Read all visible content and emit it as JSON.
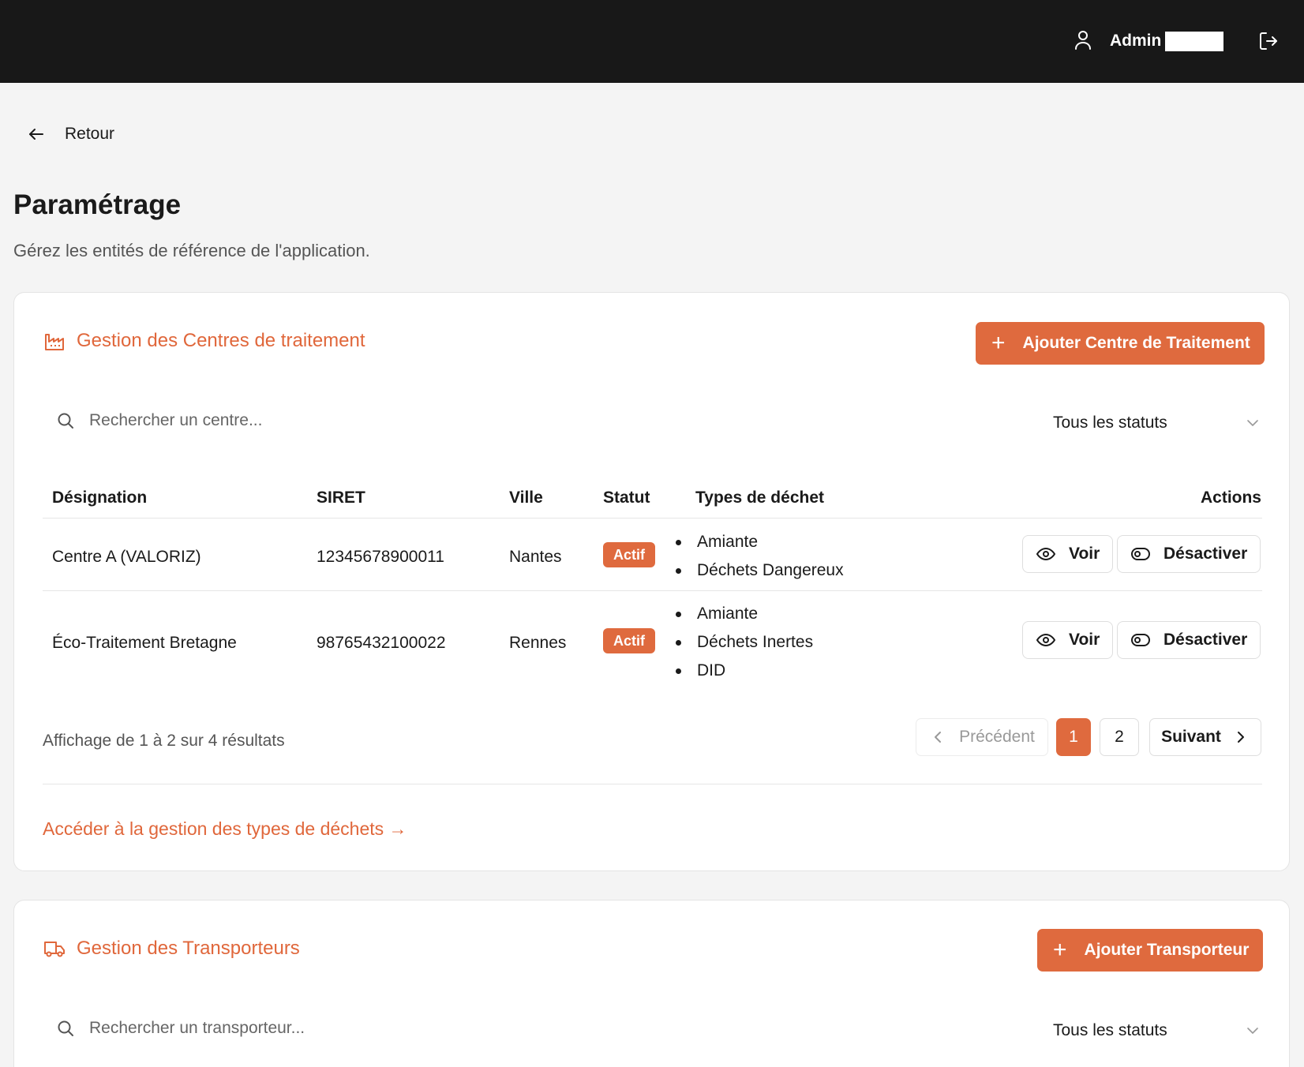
{
  "header": {
    "user_icon": "user-icon",
    "user_name": "Admin",
    "logout_icon": "logout-icon"
  },
  "nav": {
    "back_icon": "arrow-left-icon",
    "back_label": "Retour"
  },
  "page": {
    "title": "Paramétrage",
    "subtitle": "Gérez les entités de référence de l'application."
  },
  "centres": {
    "icon": "factory-icon",
    "title": "Gestion des Centres de traitement",
    "add_label": "Ajouter Centre de Traitement",
    "add_icon": "plus-icon",
    "search_placeholder": "Rechercher un centre...",
    "status_filter": "Tous les statuts",
    "columns": {
      "designation": "Désignation",
      "siret": "SIRET",
      "ville": "Ville",
      "statut": "Statut",
      "types": "Types de déchet",
      "actions": "Actions"
    },
    "rows": [
      {
        "designation": "Centre A (VALORIZ)",
        "siret": "12345678900011",
        "ville": "Nantes",
        "statut": "Actif",
        "types": [
          "Amiante",
          "Déchets Dangereux"
        ],
        "view_label": "Voir",
        "deactivate_label": "Désactiver"
      },
      {
        "designation": "Éco-Traitement Bretagne",
        "siret": "98765432100022",
        "ville": "Rennes",
        "statut": "Actif",
        "types": [
          "Amiante",
          "Déchets Inertes",
          "DID"
        ],
        "view_label": "Voir",
        "deactivate_label": "Désactiver"
      }
    ],
    "results_text": "Affichage de 1 à 2 sur 4 résultats",
    "pagination": {
      "previous": "Précédent",
      "pages": [
        "1",
        "2"
      ],
      "current_page": "1",
      "next": "Suivant"
    },
    "waste_types_link": "Accéder à la gestion des types de déchets →"
  },
  "transporteurs": {
    "icon": "truck-icon",
    "title": "Gestion des Transporteurs",
    "add_label": "Ajouter Transporteur",
    "add_icon": "plus-icon",
    "search_placeholder": "Rechercher un transporteur...",
    "status_filter": "Tous les statuts"
  },
  "colors": {
    "accent": "#df6a3e",
    "topbar": "#181818",
    "background": "#f4f4f4"
  }
}
